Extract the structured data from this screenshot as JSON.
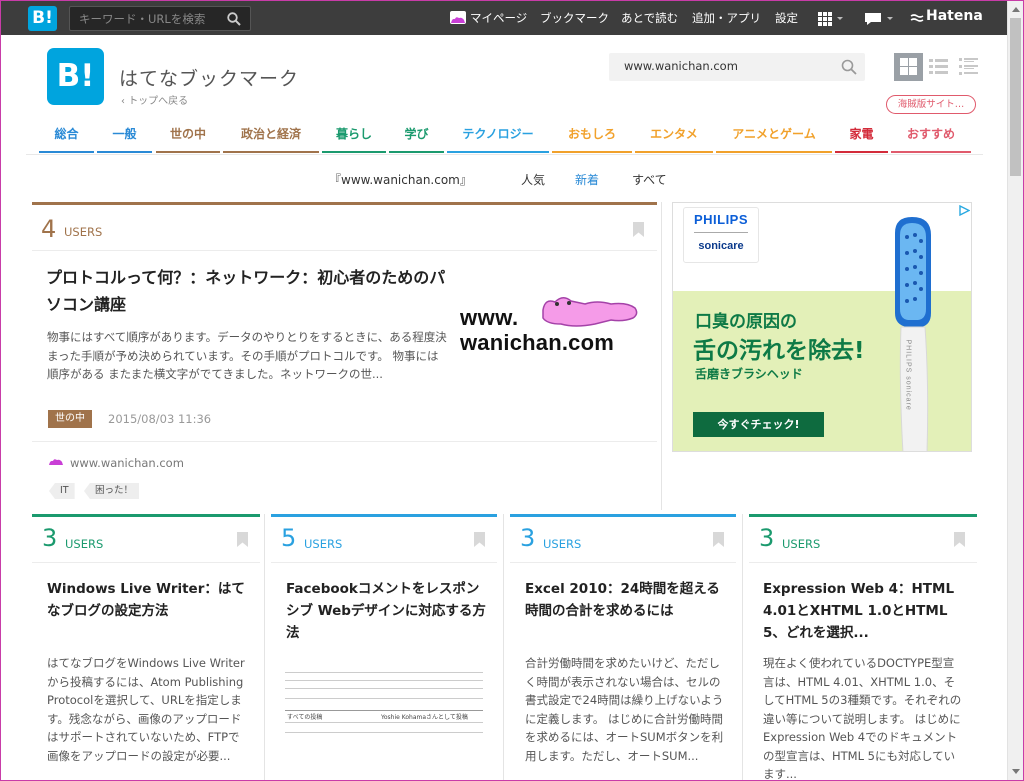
{
  "topbar": {
    "logo": "B!",
    "search_placeholder": "キーワード・URLを検索",
    "links": [
      "マイページ",
      "ブックマーク",
      "あとで読む",
      "追加・アプリ",
      "設定"
    ],
    "hatena": "Hatena"
  },
  "header": {
    "logo": "B!",
    "title": "はてなブックマーク",
    "back": "トップへ戻る",
    "domain_value": "www.wanichan.com",
    "kaizoku": "海賊版サイト…"
  },
  "nav": {
    "items": [
      {
        "label": "総合",
        "color": "#2a8ad6"
      },
      {
        "label": "一般",
        "color": "#2a8ad6"
      },
      {
        "label": "世の中",
        "color": "#a0734b"
      },
      {
        "label": "政治と経済",
        "color": "#a0734b"
      },
      {
        "label": "暮らし",
        "color": "#1b9a6e"
      },
      {
        "label": "学び",
        "color": "#1b9a6e"
      },
      {
        "label": "テクノロジー",
        "color": "#2aa1e0"
      },
      {
        "label": "おもしろ",
        "color": "#f1a12b"
      },
      {
        "label": "エンタメ",
        "color": "#f1a12b"
      },
      {
        "label": "アニメとゲーム",
        "color": "#f1a12b"
      },
      {
        "label": "家電",
        "color": "#d32b3a"
      },
      {
        "label": "おすすめ",
        "color": "#e05a6c"
      }
    ]
  },
  "subnav": {
    "site": "『www.wanichan.com』",
    "popular": "人気",
    "new": "新着",
    "all": "すべて"
  },
  "featured": {
    "users_count": "4",
    "users_label": "USERS",
    "title": "プロトコルって何？：ネットワーク：初心者のためのパソコン講座",
    "description": "物事にはすべて順序があります。データのやりとりをするときに、ある程度決まった手順が予め決められています。その手順がプロトコルです。 物事には順序がある またまた横文字がでてきました。ネットワークの世...",
    "category": "世の中",
    "date": "2015/08/03 11:36",
    "site": "www.wanichan.com",
    "tags": [
      "IT",
      "困った！"
    ],
    "logo_text": "www.\nwanichan.com"
  },
  "cards": [
    {
      "users_count": "3",
      "users_label": "USERS",
      "title": "Windows Live Writer：はてなブログの設定方法",
      "description": "はてなブログをWindows Live Writerから投稿するには、Atom Publishing Protocolを選択して、URLを指定します。残念ながら、画像のアップロードはサポートされていないため、FTPで画像をアップロードの設定が必要..."
    },
    {
      "users_count": "5",
      "users_label": "USERS",
      "title": "Facebookコメントをレスポンシブ Webデザインに対応する方法",
      "thumb_lines": [
        "すべての投稿",
        "Yoshie Kohamaさんとして投稿"
      ]
    },
    {
      "users_count": "3",
      "users_label": "USERS",
      "title": "Excel 2010：24時間を超える時間の合計を求めるには",
      "description": "合計労働時間を求めたいけど、ただしく時間が表示されない場合は、セルの書式設定で24時間は繰り上げないように定義します。 はじめに合計労働時間を求めるには、オートSUMボタンを利用します。ただし、オートSUM..."
    },
    {
      "users_count": "3",
      "users_label": "USERS",
      "title": "Expression Web 4：HTML 4.01とXHTML 1.0とHTML 5、どれを選択...",
      "description": "現在よく使われているDOCTYPE型宣言は、HTML 4.01、XHTML 1.0、そしてHTML 5の3種類です。それぞれの違い等について説明します。 はじめにExpression Web 4でのドキュメントの型宣言は、HTML 5にも対応しています..."
    }
  ],
  "ad": {
    "brand": "PHILIPS",
    "sub_brand": "sonicare",
    "line1": "口臭の原因の",
    "line2": "舌の汚れを除去!",
    "line3": "舌磨きブラシヘッド",
    "cta": "今すぐチェック!",
    "handle_text": "PHILIPS sonicare"
  }
}
